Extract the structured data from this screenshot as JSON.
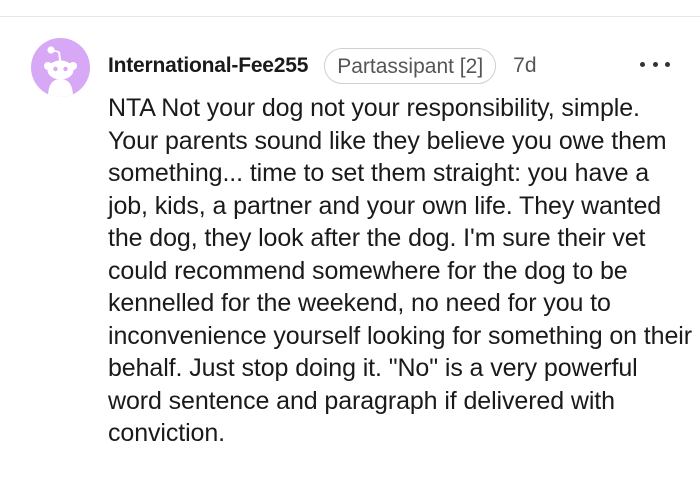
{
  "comment": {
    "username": "International-Fee255",
    "flair": "Partassipant [2]",
    "age": "7d",
    "avatar_color": "#d7a8f5",
    "more_icon": "ellipsis-horizontal-icon",
    "body": "NTA Not your dog not your responsibility, simple. Your parents sound like they believe you owe them something... time to set them straight: you have a job, kids, a partner and your own life. They wanted the dog, they look after the dog. I'm sure their vet could recommend somewhere for the dog to be kennelled for the weekend, no need for you to inconvenience yourself looking for something on their behalf. Just stop doing it. \"No\" is a very powerful word sentence and paragraph if delivered with conviction."
  }
}
